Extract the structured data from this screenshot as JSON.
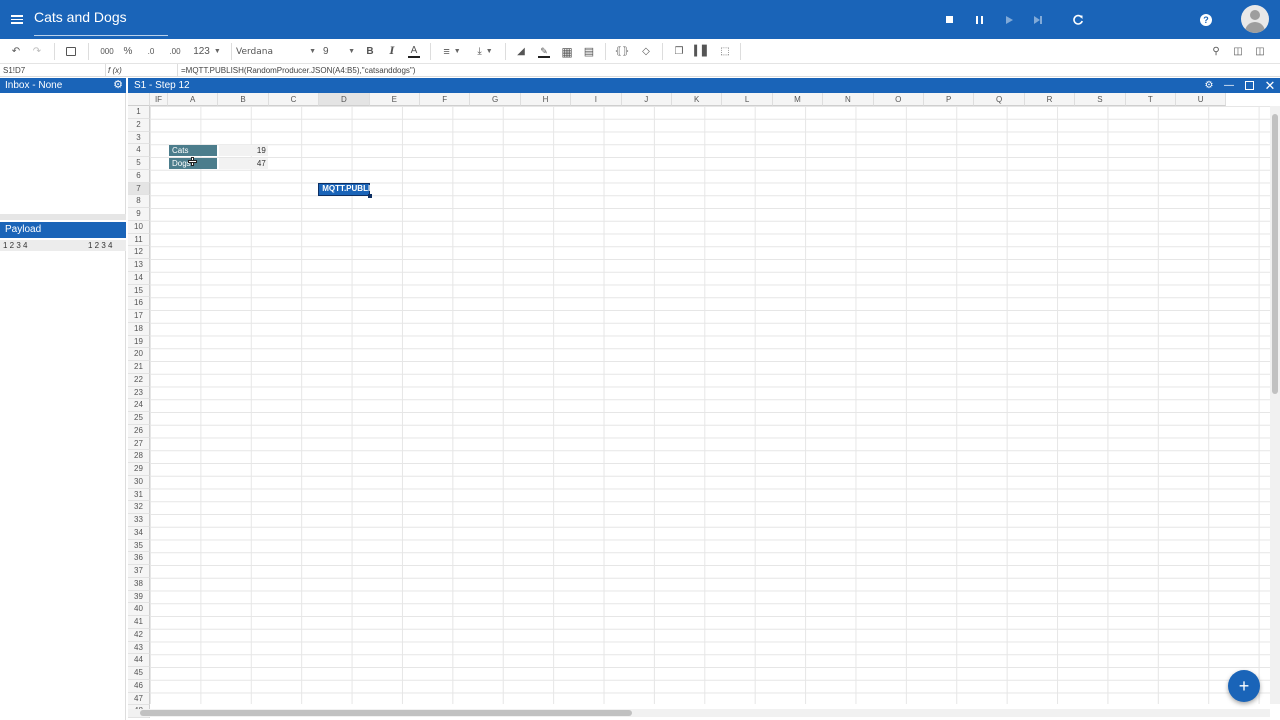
{
  "app": {
    "title": "Cats and Dogs",
    "controls": [
      "stop-icon",
      "pause-icon",
      "step-icon",
      "skip-icon",
      "refresh-icon",
      "help-icon"
    ]
  },
  "toolbar": {
    "font_name": "Verdana",
    "font_size": "9",
    "number_format": "123",
    "thousands": "000",
    "percent": "%",
    "dec_minus": ".0",
    "dec_plus": ".00"
  },
  "formula_bar": {
    "cell_ref": "S1!D7",
    "fx_label": "f (x)",
    "formula": "=MQTT.PUBLISH(RandomProducer.JSON(A4:B5),\"catsanddogs\")"
  },
  "inbox": {
    "title": "Inbox - None"
  },
  "payload": {
    "title": "Payload",
    "left_nums": "1 2 3 4",
    "right_nums": "1 2 3 4"
  },
  "sheet": {
    "title": "S1 - Step 12",
    "corner_label": "IF",
    "columns": [
      "A",
      "B",
      "C",
      "D",
      "E",
      "F",
      "G",
      "H",
      "I",
      "J",
      "K",
      "L",
      "M",
      "N",
      "O",
      "P",
      "Q",
      "R",
      "S",
      "T",
      "U"
    ],
    "selected_column": "D",
    "selected_row": 7,
    "rows": 48,
    "cells": {
      "A4": "Cats",
      "B4": "19",
      "A5": "Dogs",
      "B5": "47",
      "D7": "MQTT.PUBLISH"
    }
  },
  "colors": {
    "primary": "#1a64b8",
    "label_fill": "#4c7d8c"
  }
}
